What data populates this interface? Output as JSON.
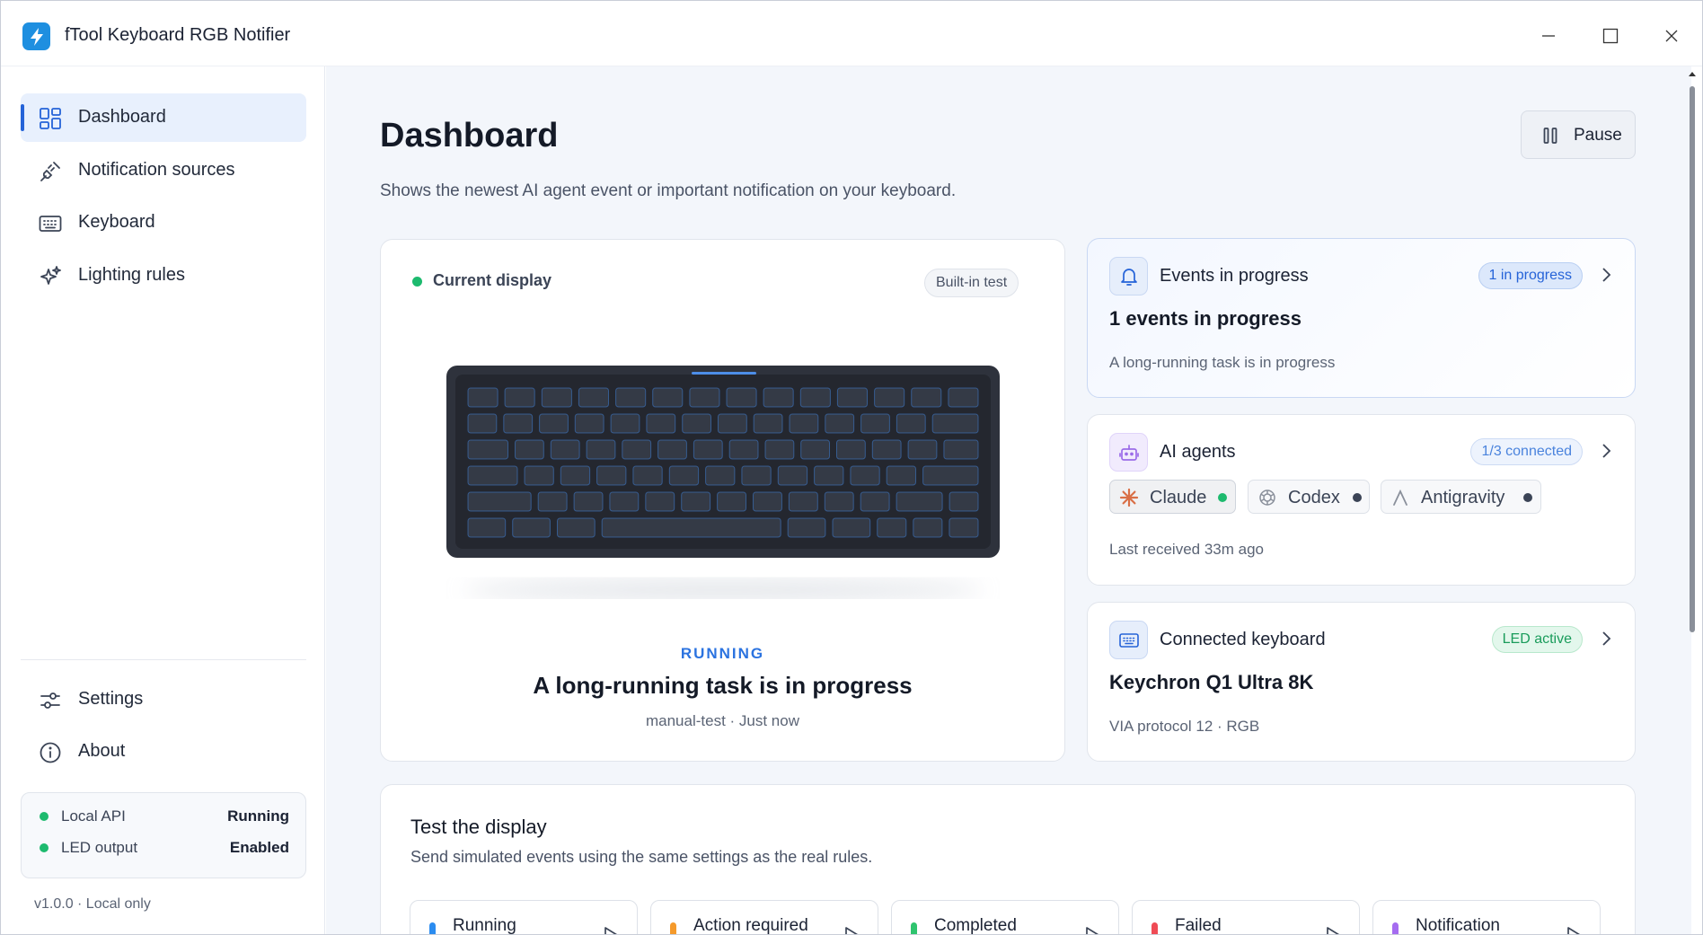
{
  "window": {
    "title": "fTool Keyboard RGB Notifier"
  },
  "sidebar": {
    "items": [
      {
        "label": "Dashboard",
        "icon": "dashboard-icon"
      },
      {
        "label": "Notification sources",
        "icon": "plug-icon"
      },
      {
        "label": "Keyboard",
        "icon": "keyboard-icon"
      },
      {
        "label": "Lighting rules",
        "icon": "sparkle-icon"
      }
    ],
    "bottom_items": [
      {
        "label": "Settings",
        "icon": "sliders-icon"
      },
      {
        "label": "About",
        "icon": "info-icon"
      }
    ],
    "status": [
      {
        "key": "Local API",
        "value": "Running"
      },
      {
        "key": "LED output",
        "value": "Enabled"
      }
    ],
    "version": "v1.0.0 · Local only"
  },
  "page": {
    "title": "Dashboard",
    "subtitle": "Shows the newest AI agent event or important notification on your keyboard.",
    "pause_label": "Pause"
  },
  "display": {
    "label": "Current display",
    "badge": "Built-in test",
    "state": "RUNNING",
    "title": "A long-running task is in progress",
    "meta": "manual-test · Just now"
  },
  "events": {
    "title": "Events in progress",
    "badge": "1 in progress",
    "big": "1 events in progress",
    "sub": "A long-running task is in progress"
  },
  "agents": {
    "title": "AI agents",
    "badge": "1/3 connected",
    "chips": [
      {
        "name": "Claude",
        "status_color": "#1dba6e"
      },
      {
        "name": "Codex",
        "status_color": "#3b4456"
      },
      {
        "name": "Antigravity",
        "status_color": "#3b4456"
      }
    ],
    "last_received": "Last received 33m ago"
  },
  "keyboard": {
    "title": "Connected keyboard",
    "badge": "LED active",
    "name": "Keychron Q1 Ultra 8K",
    "sub": "VIA protocol 12 · RGB"
  },
  "test": {
    "title": "Test the display",
    "subtitle": "Send simulated events using the same settings as the real rules.",
    "buttons": [
      {
        "label": "Running",
        "color": "#2b8cf0"
      },
      {
        "label": "Action required",
        "color": "#f59a2b"
      },
      {
        "label": "Completed",
        "color": "#2fc46e"
      },
      {
        "label": "Failed",
        "color": "#ef4b55"
      },
      {
        "label": "Notification",
        "color": "#a56cf0"
      }
    ]
  },
  "colors": {
    "accent": "#2563d8",
    "success": "#1dba6e"
  }
}
